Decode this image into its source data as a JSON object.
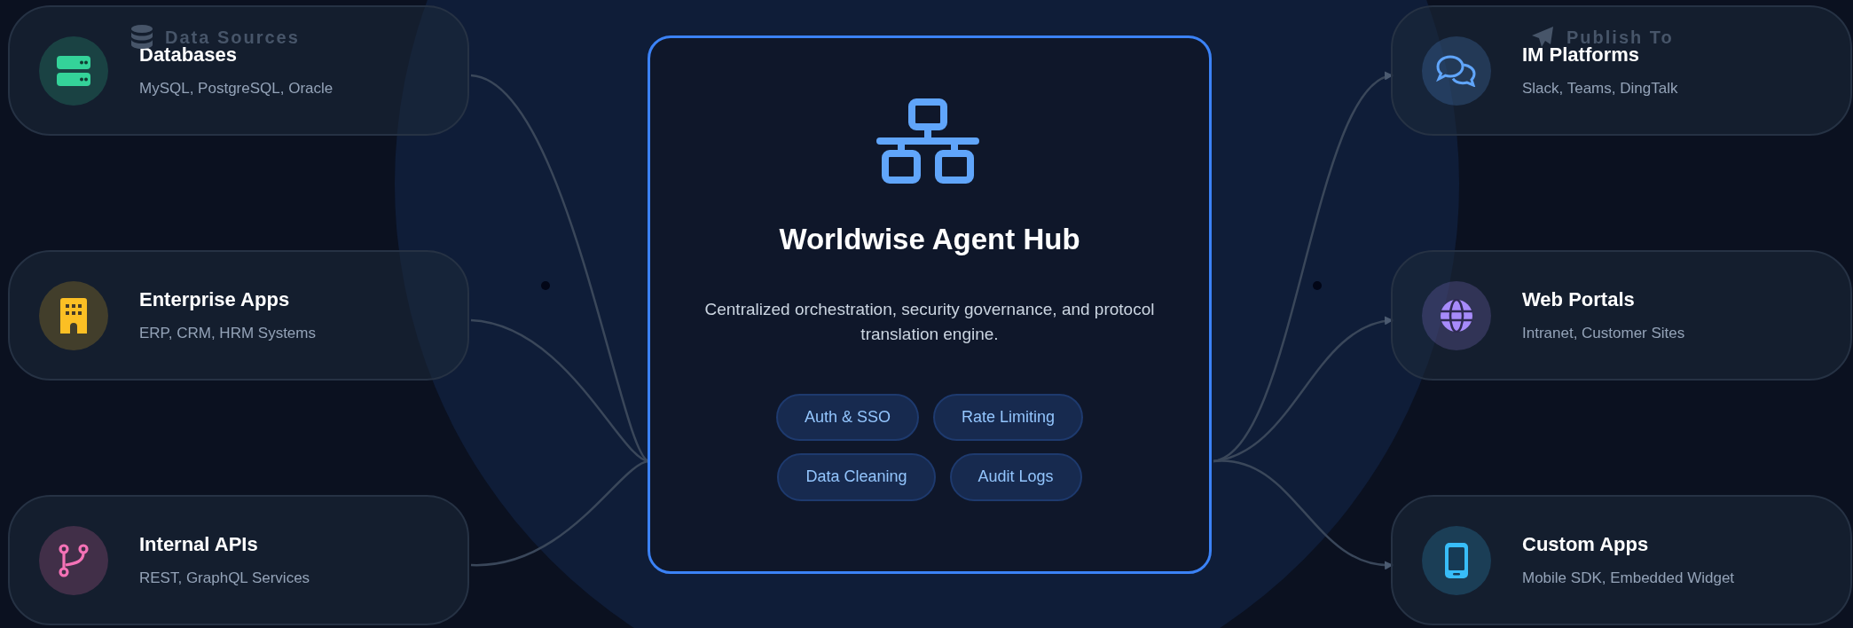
{
  "sources": {
    "heading": "Data Sources",
    "items": [
      {
        "title": "Databases",
        "subtitle": "MySQL, PostgreSQL, Oracle",
        "color": "#34d399"
      },
      {
        "title": "Enterprise Apps",
        "subtitle": "ERP, CRM, HRM Systems",
        "color": "#fbbf24"
      },
      {
        "title": "Internal APIs",
        "subtitle": "REST, GraphQL Services",
        "color": "#f472b6"
      }
    ]
  },
  "hub": {
    "title": "Worldwise Agent Hub",
    "description": "Centralized orchestration, security governance, and protocol translation engine.",
    "tags": [
      "Auth & SSO",
      "Rate Limiting",
      "Data Cleaning",
      "Audit Logs"
    ]
  },
  "targets": {
    "heading": "Publish To",
    "items": [
      {
        "title": "IM Platforms",
        "subtitle": "Slack, Teams, DingTalk",
        "color": "#60a5fa"
      },
      {
        "title": "Web Portals",
        "subtitle": "Intranet, Customer Sites",
        "color": "#a78bfa"
      },
      {
        "title": "Custom Apps",
        "subtitle": "Mobile SDK, Embedded Widget",
        "color": "#38bdf8"
      }
    ]
  }
}
